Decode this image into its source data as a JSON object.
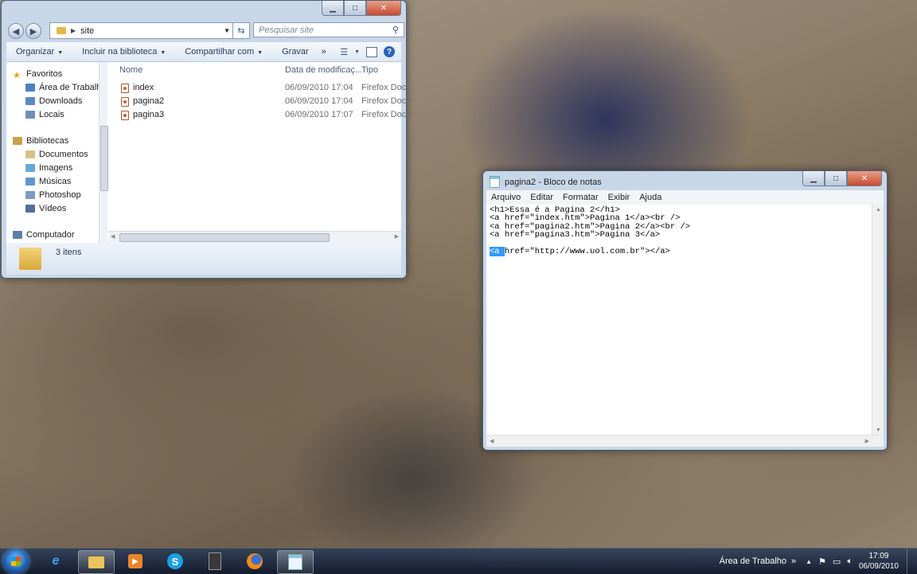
{
  "explorer": {
    "address_folder": "site",
    "search_placeholder": "Pesquisar site",
    "toolbar": {
      "organize": "Organizar",
      "include_library": "Incluir na biblioteca",
      "share": "Compartilhar com",
      "burn": "Gravar",
      "more": "»"
    },
    "nav": {
      "favorites": "Favoritos",
      "desktop": "Área de Trabalho",
      "downloads": "Downloads",
      "places": "Locais",
      "libraries": "Bibliotecas",
      "documents": "Documentos",
      "images": "Imagens",
      "music": "Músicas",
      "photoshop": "Photoshop",
      "videos": "Vídeos",
      "computer": "Computador"
    },
    "columns": {
      "name": "Nome",
      "date": "Data de modificaç...",
      "type": "Tipo"
    },
    "files": [
      {
        "name": "index",
        "date": "06/09/2010 17:04",
        "type": "Firefox Docu"
      },
      {
        "name": "pagina2",
        "date": "06/09/2010 17:04",
        "type": "Firefox Docu"
      },
      {
        "name": "pagina3",
        "date": "06/09/2010 17:07",
        "type": "Firefox Docu"
      }
    ],
    "status": "3 itens"
  },
  "notepad": {
    "title": "pagina2 - Bloco de notas",
    "menu": {
      "file": "Arquivo",
      "edit": "Editar",
      "format": "Formatar",
      "view": "Exibir",
      "help": "Ajuda"
    },
    "lines": [
      "<h1>Essa é a Pagina 2</h1>",
      "<a href=\"index.htm\">Pagina 1</a><br />",
      "<a href=\"pagina2.htm\">Pagina 2</a><br />",
      "<a href=\"pagina3.htm\">Pagina 3</a>",
      ""
    ],
    "last_line_selected": "<a ",
    "last_line_rest": "href=\"http://www.uol.com.br\">​</a>"
  },
  "taskbar": {
    "desktop_label": "Área de Trabalho",
    "expand": "»",
    "time": "17:09",
    "date": "06/09/2010"
  }
}
